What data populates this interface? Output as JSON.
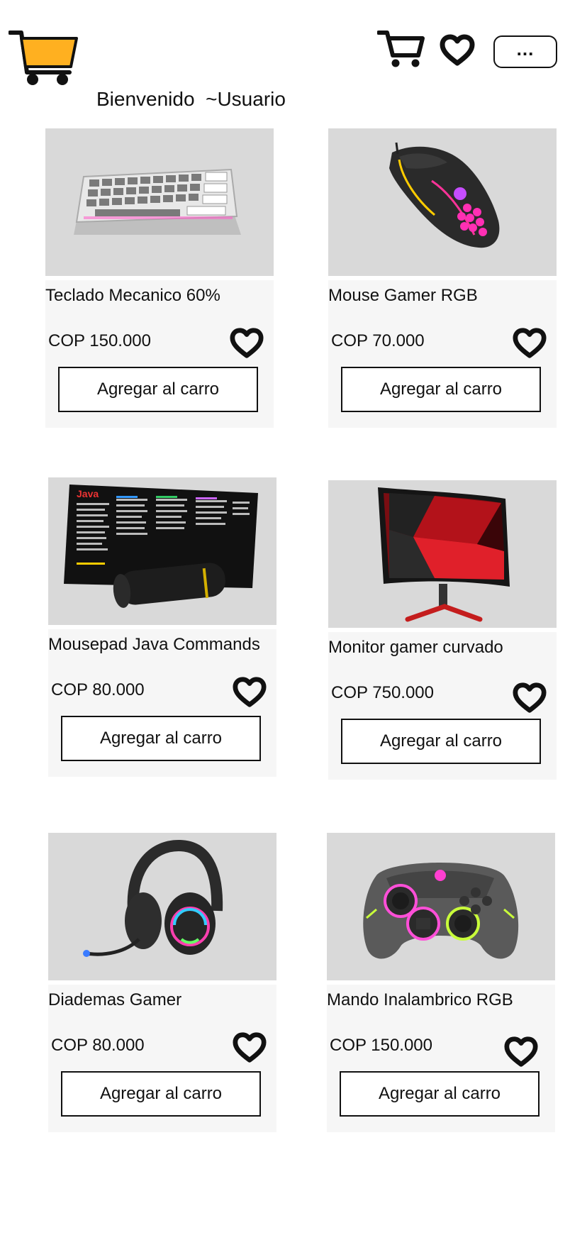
{
  "header": {
    "logo_icon": "shopping-cart-logo",
    "cart_icon": "cart-icon",
    "favorites_icon": "heart-icon",
    "more_label": "...",
    "welcome": "Bienvenido  ~Usuario"
  },
  "colors": {
    "logo_fill": "#FFB020",
    "image_bg": "#D9D9D9",
    "card_bg": "#F6F6F6"
  },
  "products": [
    {
      "name": "Teclado Mecanico 60%",
      "price": "COP 150.000",
      "button": "Agregar al carro",
      "image": "keyboard"
    },
    {
      "name": "Mouse Gamer RGB",
      "price": "COP 70.000",
      "button": "Agregar al carro",
      "image": "mouse"
    },
    {
      "name": "Mousepad Java Commands",
      "price": "COP 80.000",
      "button": "Agregar al carro",
      "image": "mousepad"
    },
    {
      "name": "Monitor gamer curvado",
      "price": "COP 750.000",
      "button": "Agregar al carro",
      "image": "monitor"
    },
    {
      "name": "Diademas Gamer",
      "price": "COP 80.000",
      "button": "Agregar al carro",
      "image": "headset"
    },
    {
      "name": "Mando Inalambrico RGB",
      "price": "COP 150.000",
      "button": "Agregar al carro",
      "image": "controller"
    }
  ]
}
